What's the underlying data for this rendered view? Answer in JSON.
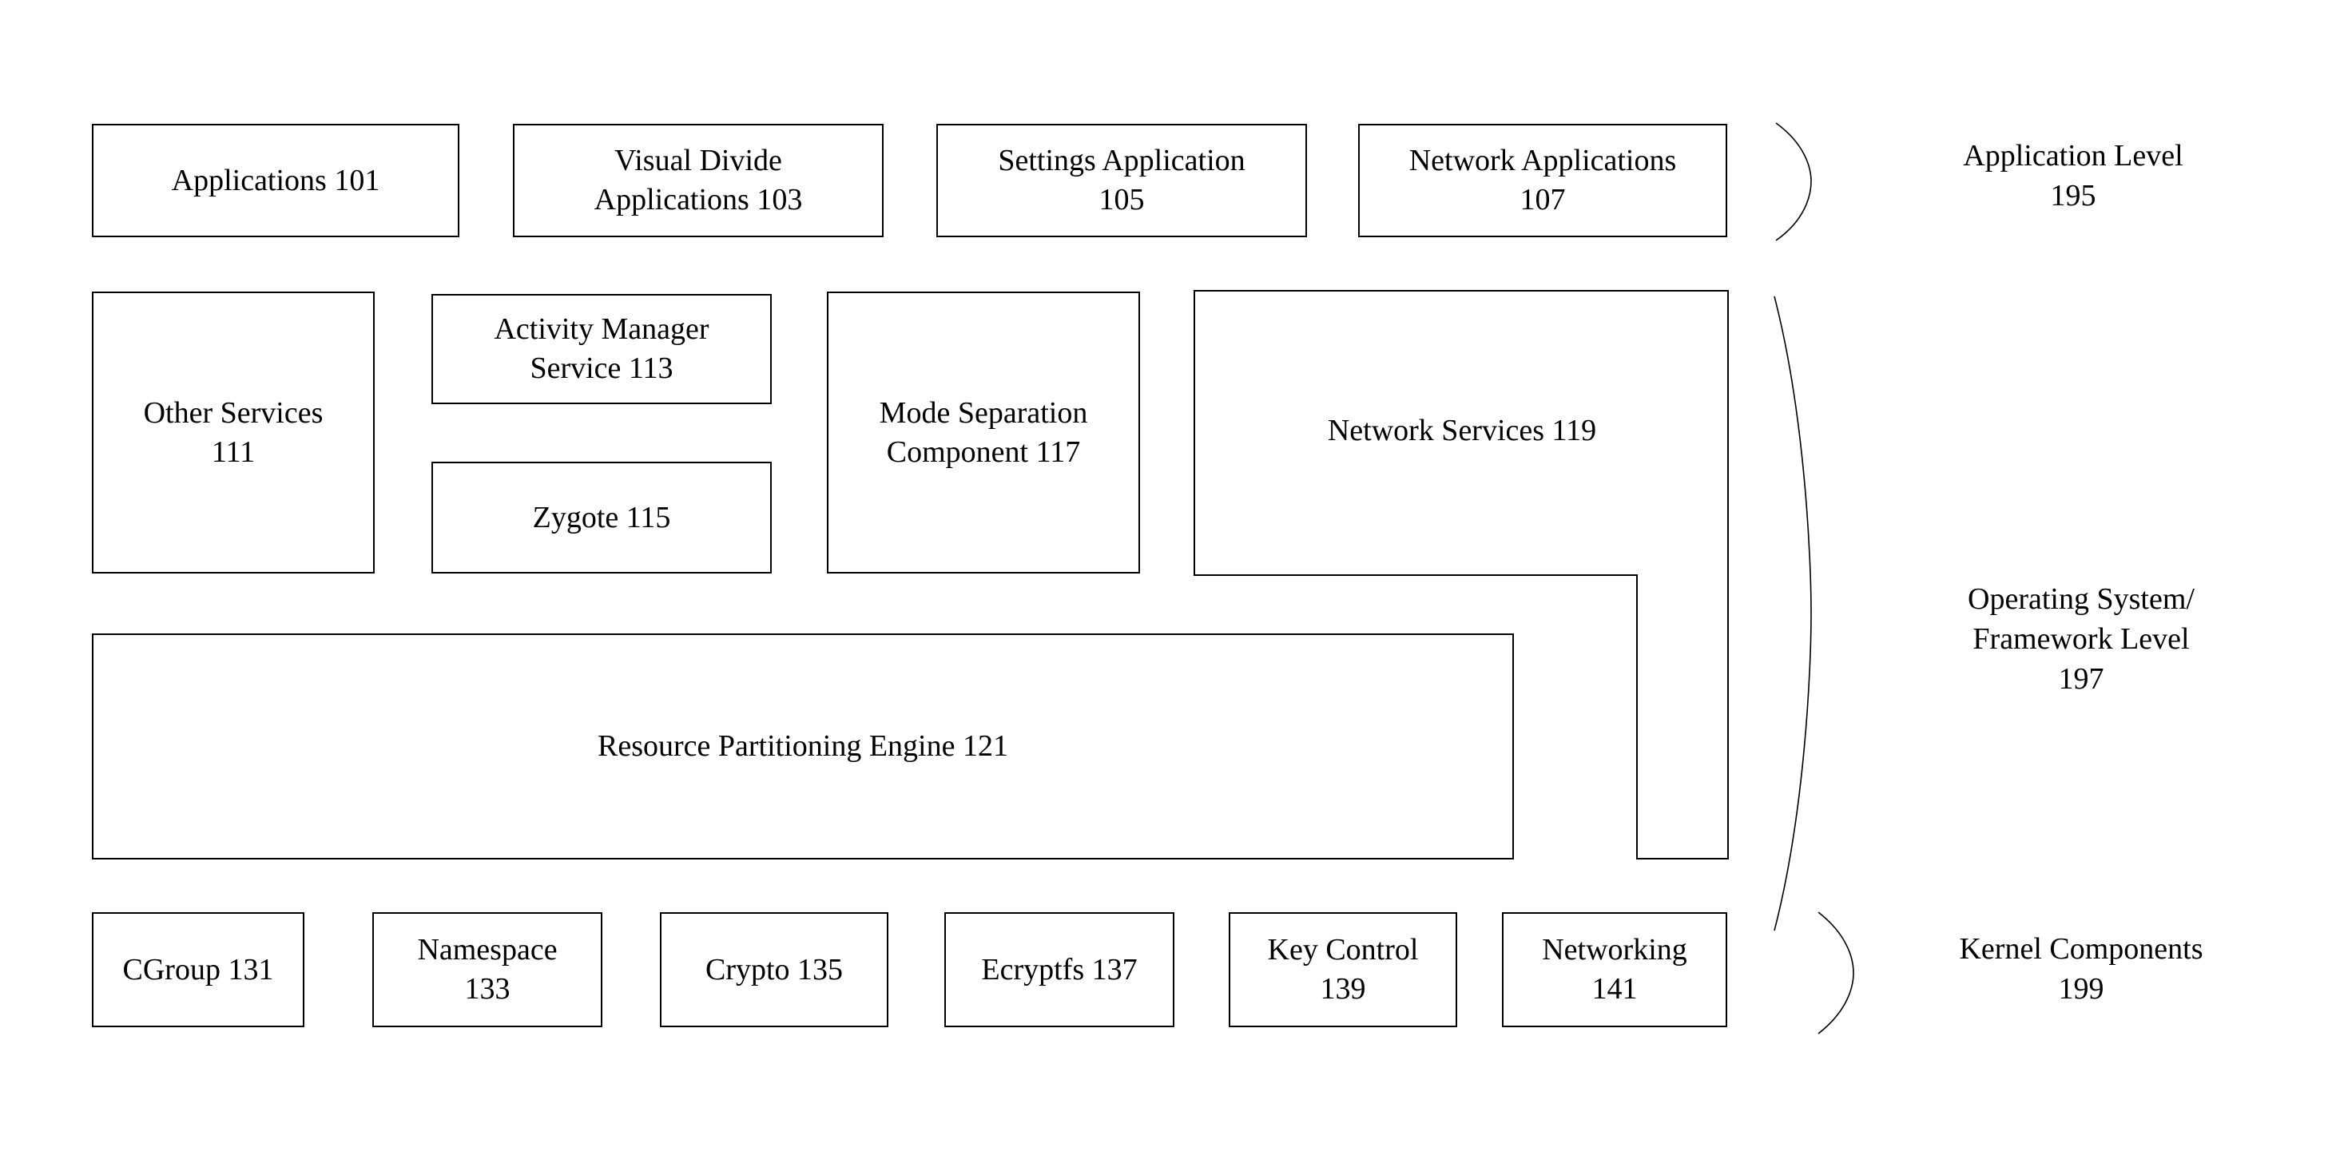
{
  "figure": {
    "title": "System architecture layer diagram",
    "stroke_color": "#000000",
    "background_color": "#ffffff"
  },
  "application_level": {
    "boxes": [
      {
        "label": "Applications 101"
      },
      {
        "label": "Visual Divide\nApplications 103"
      },
      {
        "label": "Settings Application\n105"
      },
      {
        "label": "Network Applications\n107"
      }
    ],
    "tier_label": "Application Level\n195"
  },
  "os_framework_level": {
    "boxes": [
      {
        "label": "Other Services\n111"
      },
      {
        "label": "Activity Manager\nService 113"
      },
      {
        "label": "Zygote 115"
      },
      {
        "label": "Mode Separation\nComponent 117"
      },
      {
        "label": "Network Services 119"
      },
      {
        "label": "Resource Partitioning Engine 121"
      }
    ],
    "tier_label": "Operating System/\nFramework Level\n197"
  },
  "kernel_components_level": {
    "boxes": [
      {
        "label": "CGroup 131"
      },
      {
        "label": "Namespace\n133"
      },
      {
        "label": "Crypto 135"
      },
      {
        "label": "Ecryptfs 137"
      },
      {
        "label": "Key Control\n139"
      },
      {
        "label": "Networking\n141"
      }
    ],
    "tier_label": "Kernel Components\n199"
  }
}
